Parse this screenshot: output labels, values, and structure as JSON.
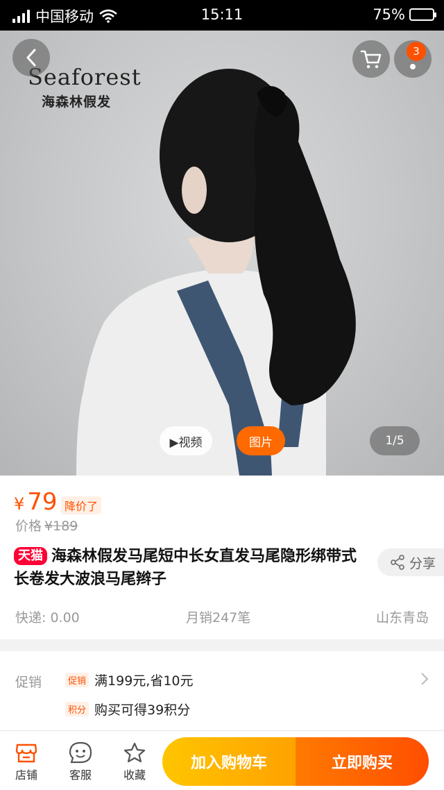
{
  "status_bar": {
    "carrier": "中国移动",
    "time": "15:11",
    "battery_text": "75%",
    "battery_level": 0.75
  },
  "hero": {
    "brand_en": "Seaforest",
    "brand_cn": "海森林假发",
    "cart_badge": "3",
    "video_label": "▶视频",
    "photo_label": "图片",
    "image_counter": "1/5"
  },
  "product": {
    "currency": "¥",
    "price": "79",
    "price_drop_tag": "降价了",
    "orig_label": "价格",
    "orig_price": "¥189",
    "store_badge": "天猫",
    "title": "海森林假发马尾短中长女直发马尾隐形绑带式长卷发大波浪马尾辫子",
    "share_label": "分享",
    "shipping": "快递: 0.00",
    "monthly_sales": "月销247笔",
    "location": "山东青岛"
  },
  "promo": {
    "label": "促销",
    "items": [
      {
        "chip": "促销",
        "text": "满199元,省10元"
      },
      {
        "chip": "积分",
        "text": "购买可得39积分"
      }
    ]
  },
  "bottom_bar": {
    "store": "店铺",
    "service": "客服",
    "favorite": "收藏",
    "add_to_cart": "加入购物车",
    "buy_now": "立即购买"
  },
  "colors": {
    "accent": "#ff5000",
    "tmall": "#ff0036",
    "cart_button": "#ffa200",
    "buy_button": "#ff5a00"
  }
}
